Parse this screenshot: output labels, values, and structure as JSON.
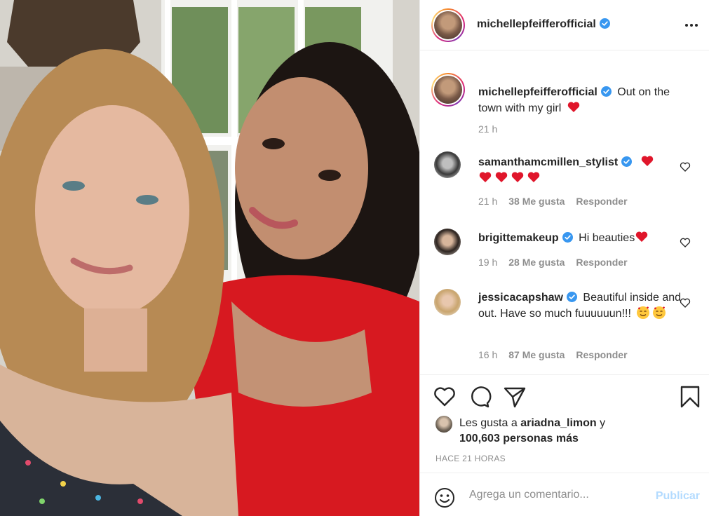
{
  "post": {
    "username": "michellepfeifferofficial",
    "caption": "Out on the town with my girl",
    "caption_time": "21 h"
  },
  "comments": [
    {
      "username": "samanthamcmillen_stylist",
      "text": "",
      "hearts": 5,
      "time": "21 h",
      "likes": "38 Me gusta",
      "reply": "Responder"
    },
    {
      "username": "brigittemakeup",
      "text": "Hi beauties",
      "time": "19 h",
      "likes": "28 Me gusta",
      "reply": "Responder"
    },
    {
      "username": "jessicacapshaw",
      "text": "Beautiful inside and out. Have so much fuuuuuun!!!",
      "time": "16 h",
      "likes": "87 Me gusta",
      "reply": "Responder"
    }
  ],
  "likes": {
    "prefix": "Les gusta a",
    "user": "ariadna_limon",
    "conj": "y",
    "count": "100,603 personas más"
  },
  "timestamp": "HACE 21 HORAS",
  "comment_box": {
    "placeholder": "Agrega un comentario...",
    "publish": "Publicar"
  },
  "colors": {
    "verified": "#3897f0",
    "heart_red": "#e0162b",
    "publish_disabled": "#b3dbff",
    "meta_gray": "#8e8e8e"
  }
}
